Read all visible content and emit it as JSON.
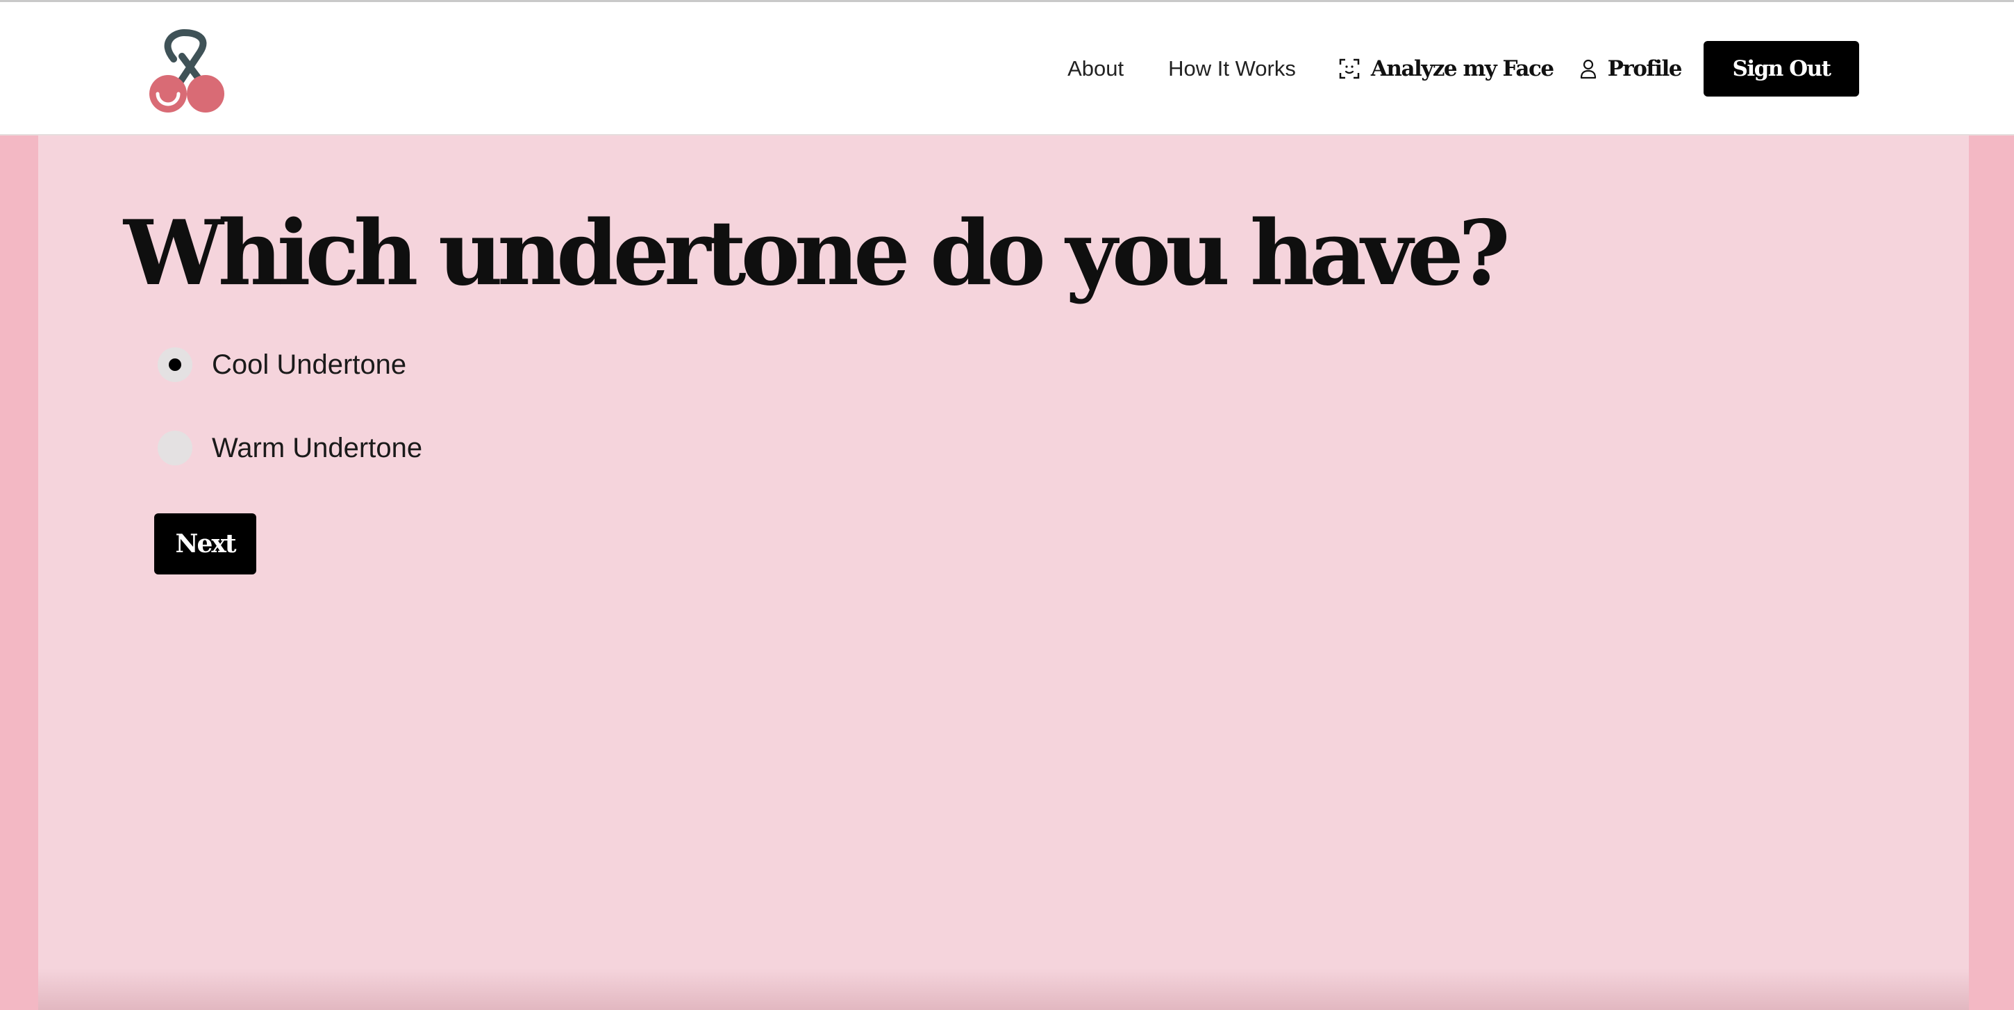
{
  "nav": {
    "about": "About",
    "how_it_works": "How It Works",
    "analyze": "Analyze my Face",
    "profile": "Profile",
    "sign_out": "Sign Out"
  },
  "quiz": {
    "question": "Which undertone do you have?",
    "options": [
      {
        "label": "Cool Undertone",
        "selected": true
      },
      {
        "label": "Warm Undertone",
        "selected": false
      }
    ],
    "next_label": "Next"
  },
  "colors": {
    "background": "#f3b8c4",
    "panel": "#f5d4dc",
    "logo_cherry": "#d96b75",
    "logo_stem": "#3f5257",
    "button": "#000000"
  },
  "icons": {
    "logo": "cherry-logo-icon",
    "analyze": "face-scan-icon",
    "profile": "user-icon"
  }
}
